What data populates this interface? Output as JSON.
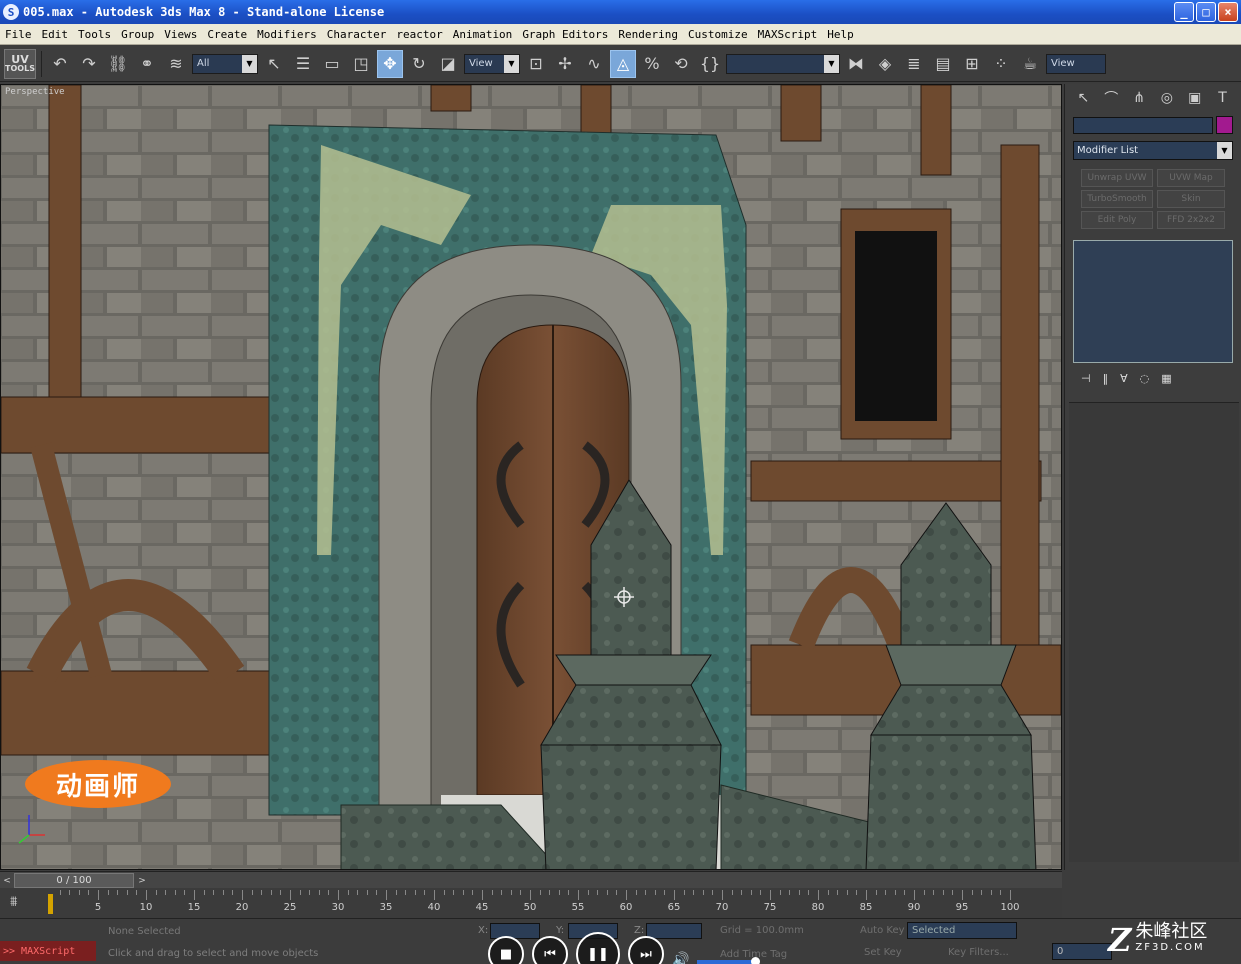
{
  "window": {
    "title": "005.max - Autodesk 3ds Max 8  - Stand-alone License",
    "min": "_",
    "max": "□",
    "close": "×"
  },
  "menu": [
    "File",
    "Edit",
    "Tools",
    "Group",
    "Views",
    "Create",
    "Modifiers",
    "Character",
    "reactor",
    "Animation",
    "Graph Editors",
    "Rendering",
    "Customize",
    "MAXScript",
    "Help"
  ],
  "toolbar": {
    "uv_line1": "UV",
    "uv_line2": "TOOLS",
    "selection_filter": "All",
    "ref_coord": "View",
    "named_selection": "",
    "view_right": "View"
  },
  "viewport": {
    "label": "Perspective",
    "badge_text": "动画师"
  },
  "command_panel": {
    "modifier_list": "Modifier List",
    "modifier_buttons": [
      "Unwrap UVW",
      "UVW Map",
      "TurboSmooth",
      "Skin",
      "Edit Poly",
      "FFD 2x2x2"
    ]
  },
  "timeline": {
    "frame_display": "0 / 100",
    "ticks": [
      5,
      10,
      15,
      20,
      25,
      30,
      35,
      40,
      45,
      50,
      55,
      60,
      65,
      70,
      75,
      80,
      85,
      90,
      95,
      100
    ],
    "range_end": 100
  },
  "status": {
    "maxscript_label": ">> MAXScript",
    "selection": "None Selected",
    "prompt": "Click and drag to select and move objects",
    "x_label": "X:",
    "y_label": "Y:",
    "z_label": "Z:",
    "grid": "Grid = 100.0mm",
    "add_time_tag": "Add Time Tag",
    "auto_key": "Auto Key",
    "set_key": "Set Key",
    "selected": "Selected",
    "key_filters": "Key Filters...",
    "frame": "0"
  },
  "site": {
    "z": "Z",
    "cn": "朱峰社区",
    "en": "ZF3D.COM"
  },
  "colors": {
    "title_bar": "#1b4fc4",
    "menu_bg": "#ece9d8",
    "ui_dark": "#3d3d3d",
    "field_blue": "#2b3d56",
    "active_tool": "#7aa7d9",
    "badge_orange": "#f07a1e"
  }
}
